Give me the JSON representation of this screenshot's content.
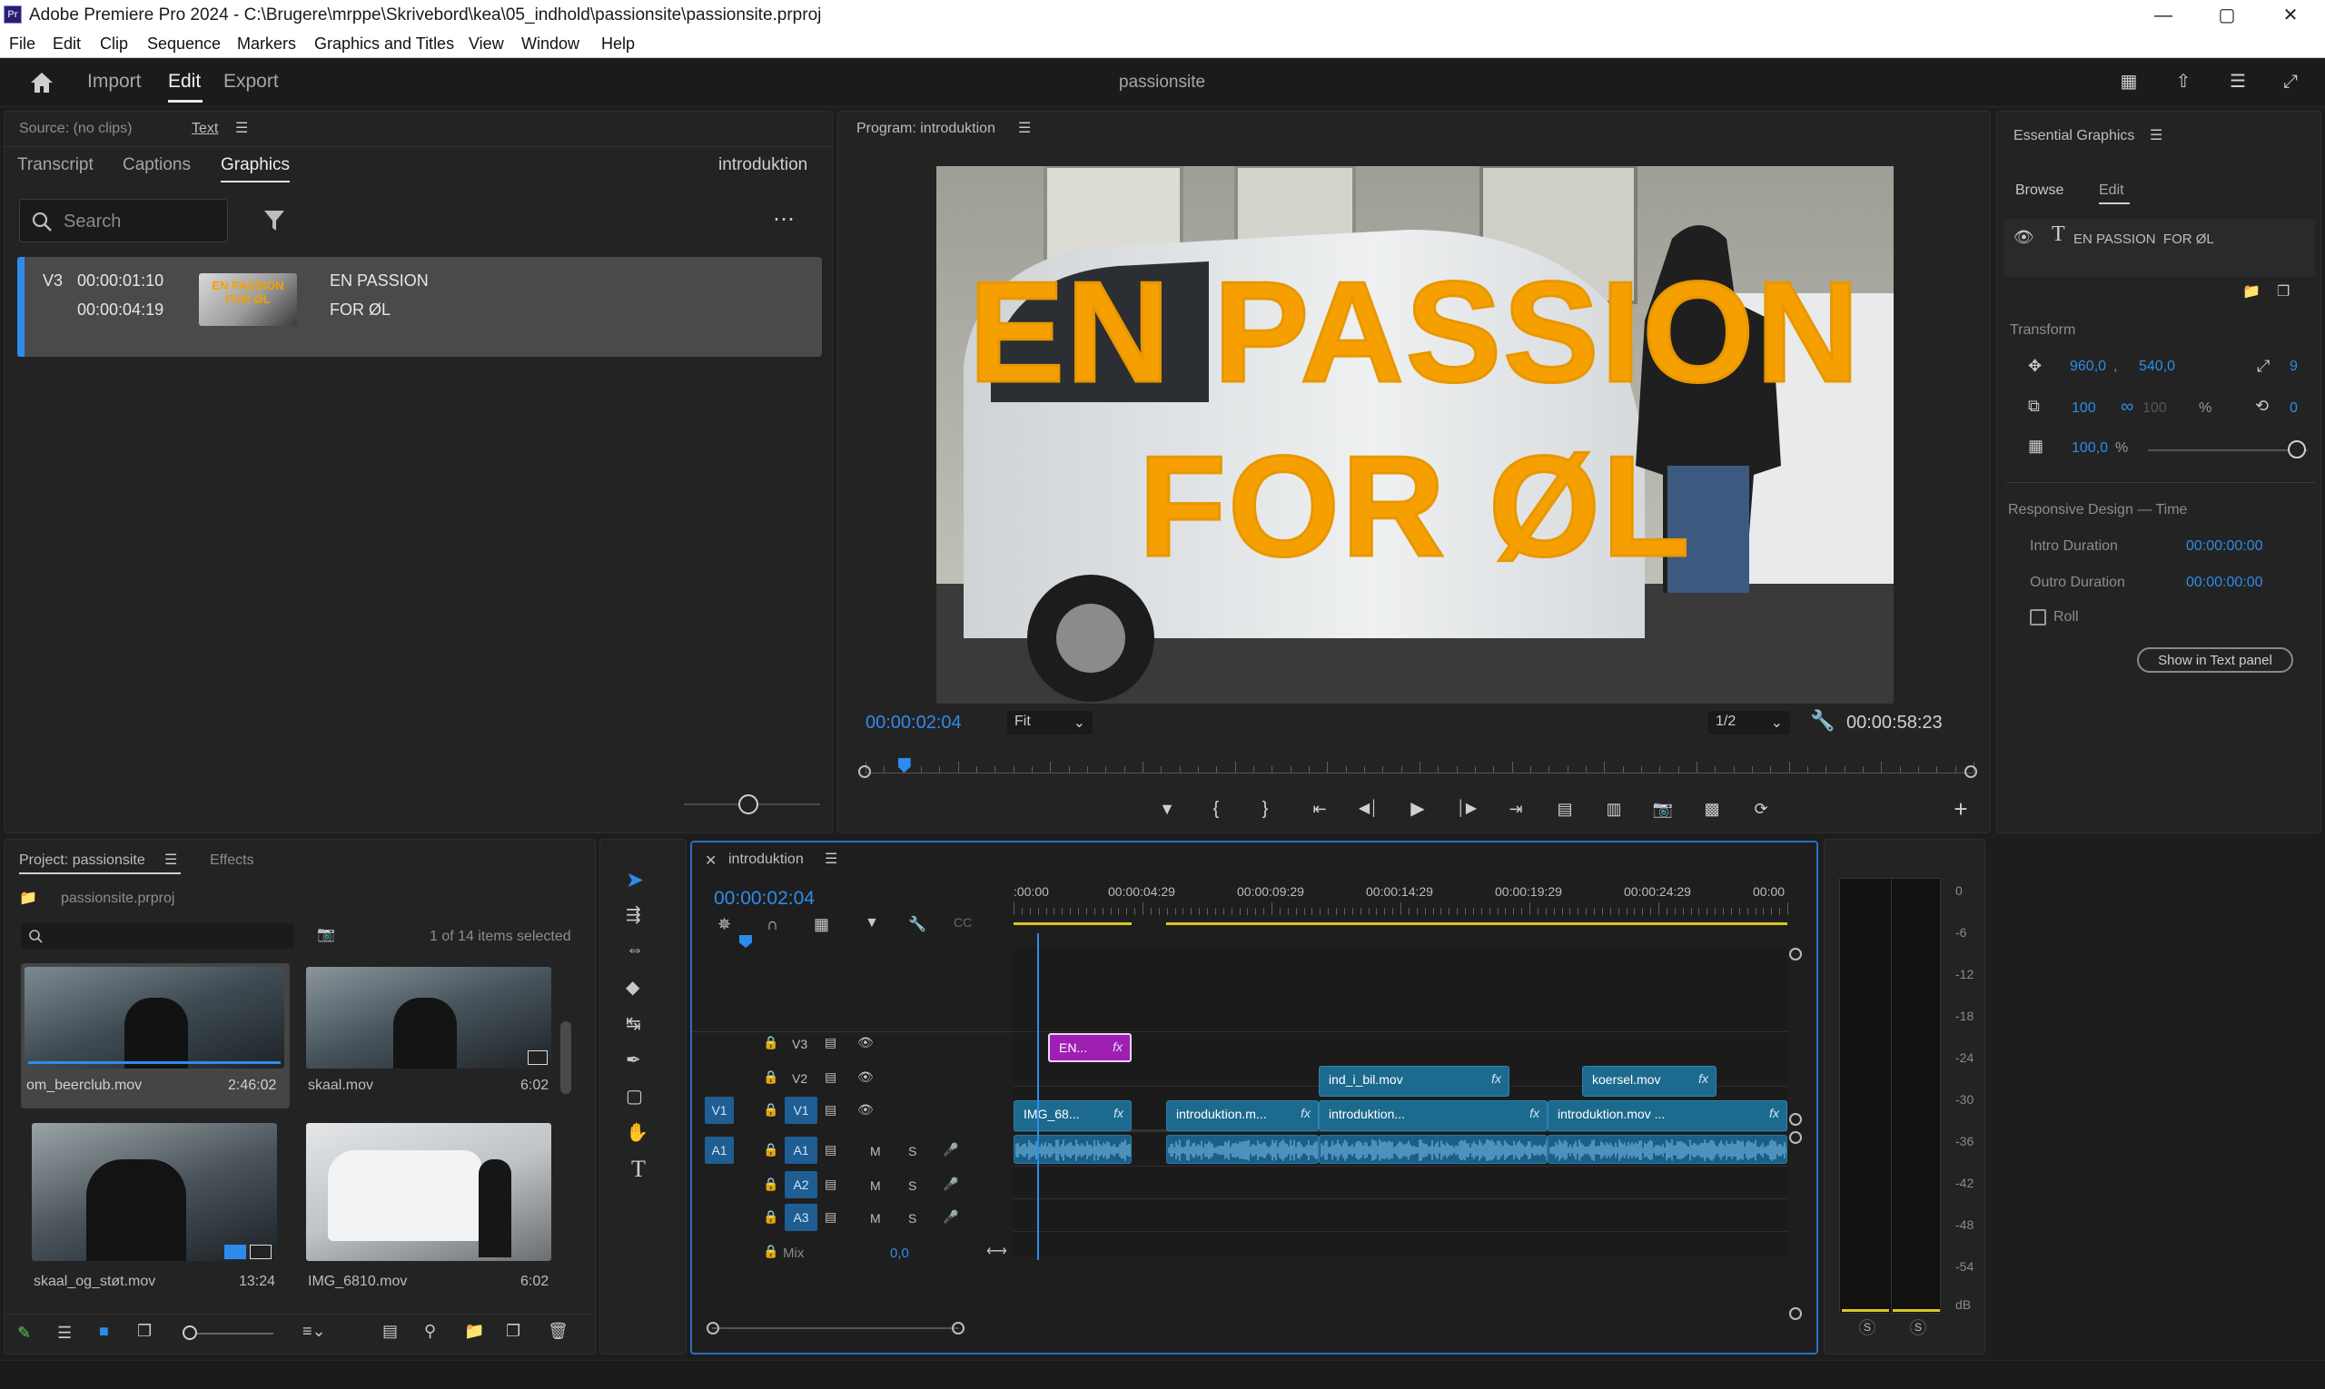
{
  "window": {
    "title": "Adobe Premiere Pro 2024 - C:\\Brugere\\mrppe\\Skrivebord\\kea\\05_indhold\\passionsite\\passionsite.prproj",
    "logo": "Pr"
  },
  "menu": [
    "File",
    "Edit",
    "Clip",
    "Sequence",
    "Markers",
    "Graphics and Titles",
    "View",
    "Window",
    "Help"
  ],
  "header": {
    "tabs": [
      "Import",
      "Edit",
      "Export"
    ],
    "active_tab": "Edit",
    "project_name": "passionsite"
  },
  "source_panel": {
    "source_label": "Source: (no clips)",
    "text_tab": "Text",
    "tabs": [
      "Transcript",
      "Captions",
      "Graphics"
    ],
    "active_tab": "Graphics",
    "sequence_name": "introduktion",
    "search_placeholder": "Search",
    "graphic_item": {
      "track": "V3",
      "in_time": "00:00:01:10",
      "out_time": "00:00:04:19",
      "thumb_text": "EN PASSION FOR ØL",
      "name_line1": "EN PASSION",
      "name_line2": "FOR ØL"
    }
  },
  "program_monitor": {
    "title": "Program: introduktion",
    "overlay_line1": "EN PASSION",
    "overlay_line2": "FOR ØL",
    "timecode": "00:00:02:04",
    "fit": "Fit",
    "resolution": "1/2",
    "duration": "00:00:58:23",
    "playhead_fraction": 0.035
  },
  "essential_graphics": {
    "title": "Essential Graphics",
    "tabs": [
      "Browse",
      "Edit"
    ],
    "active_tab": "Edit",
    "layer_name": "EN PASSION  FOR ØL",
    "transform_label": "Transform",
    "pos_x": "960,0",
    "pos_y": "540,0",
    "anchor": "9",
    "scale": "100",
    "scale_h": "100",
    "scale_unit": "%",
    "rotation": "0",
    "opacity": "100,0",
    "opacity_unit": "%",
    "responsive_label": "Responsive Design — Time",
    "intro_label": "Intro Duration",
    "intro_value": "00:00:00:00",
    "outro_label": "Outro Duration",
    "outro_value": "00:00:00:00",
    "roll_label": "Roll",
    "show_text_panel": "Show in Text panel"
  },
  "project_panel": {
    "title": "Project: passionsite",
    "effects_tab": "Effects",
    "file": "passionsite.prproj",
    "selection": "1 of 14 items selected",
    "items": [
      {
        "name": "om_beerclub.mov",
        "duration": "2:46:02",
        "selected": true
      },
      {
        "name": "skaal.mov",
        "duration": "6:02",
        "selected": false
      },
      {
        "name": "skaal_og_støt.mov",
        "duration": "13:24",
        "selected": false
      },
      {
        "name": "IMG_6810.mov",
        "duration": "6:02",
        "selected": false
      }
    ]
  },
  "timeline": {
    "sequence": "introduktion",
    "timecode": "00:00:02:04",
    "ruler": [
      ":00:00",
      "00:00:04:29",
      "00:00:09:29",
      "00:00:14:29",
      "00:00:19:29",
      "00:00:24:29",
      "00:00"
    ],
    "tracks": {
      "v3": "V3",
      "v2": "V2",
      "v1": "V1",
      "a1": "A1",
      "a2": "A2",
      "a3": "A3",
      "src_v1": "V1",
      "src_a1": "A1",
      "mix": "Mix",
      "mix_value": "0,0",
      "m": "M",
      "s": "S"
    },
    "clips": {
      "v3": "EN...",
      "v2a": "ind_i_bil.mov",
      "v2b": "koersel.mov",
      "v1a": "IMG_68...",
      "v1b": "introduktion.m...",
      "v1c": "introduktion...",
      "v1d": "introduktion.mov ...",
      "fx": "fx"
    }
  },
  "meter": {
    "labels": [
      "0",
      "-6",
      "-12",
      "-18",
      "-24",
      "-30",
      "-36",
      "-42",
      "-48",
      "-54",
      "dB"
    ],
    "solo_left": "S",
    "solo_right": "S"
  },
  "colors": {
    "accent": "#2d8ceb",
    "title_overlay": "#f5a000",
    "graphic_clip": "#a01fb3",
    "video_clip": "#1d6a8f"
  }
}
